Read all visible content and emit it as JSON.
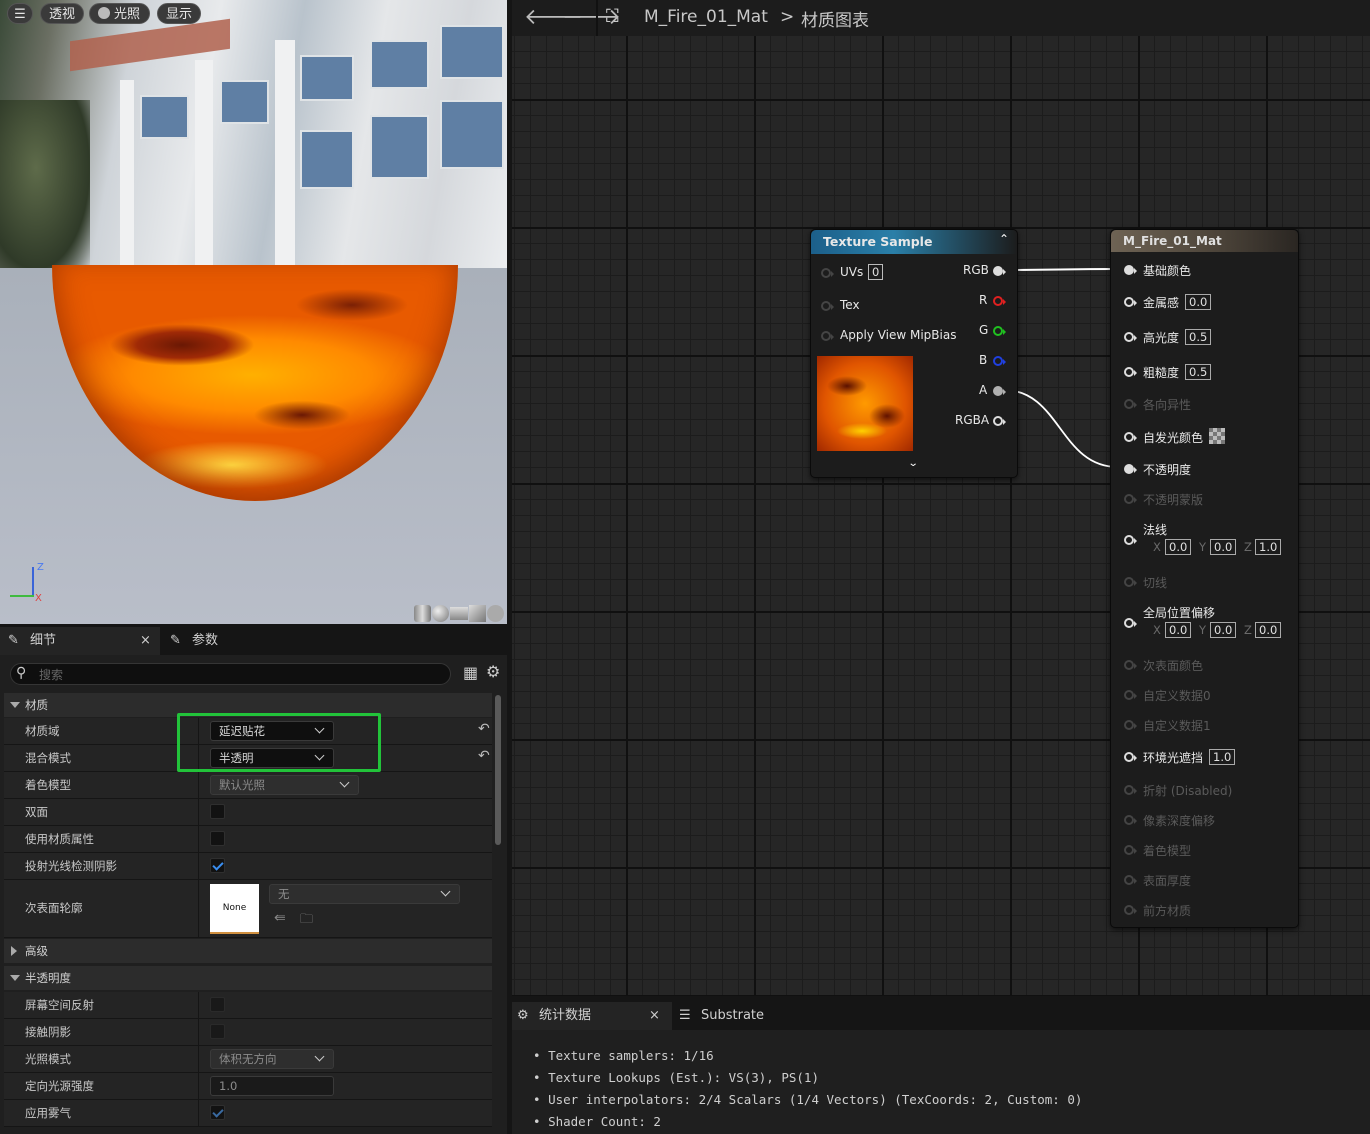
{
  "viewport": {
    "buttons": {
      "menu": "",
      "perspective": "透视",
      "lighting": "光照",
      "show": "显示"
    },
    "axis": {
      "z": "Z",
      "x": "X"
    }
  },
  "details": {
    "tabs": [
      {
        "label": "细节",
        "close": "×"
      },
      {
        "label": "参数"
      }
    ],
    "search_placeholder": "搜索",
    "sections": {
      "material": "材质",
      "advanced": "高级",
      "translucency": "半透明度"
    },
    "rows": {
      "material_domain": {
        "label": "材质域",
        "value": "延迟贴花"
      },
      "blend_mode": {
        "label": "混合模式",
        "value": "半透明"
      },
      "shading_model": {
        "label": "着色模型",
        "value": "默认光照"
      },
      "two_sided": {
        "label": "双面",
        "checked": false
      },
      "use_material_attributes": {
        "label": "使用材质属性",
        "checked": false
      },
      "cast_ray_traced_shadows": {
        "label": "投射光线检测阴影",
        "checked": true
      },
      "subsurface_profile": {
        "label": "次表面轮廓",
        "thumb": "None",
        "value": "无"
      },
      "screen_space_reflections": {
        "label": "屏幕空间反射",
        "checked": false
      },
      "contact_shadows": {
        "label": "接触阴影",
        "checked": false
      },
      "lighting_mode": {
        "label": "光照模式",
        "value": "体积无方向"
      },
      "directional_light_intensity": {
        "label": "定向光源强度",
        "value": "1.0"
      },
      "apply_fog": {
        "label": "应用雾气",
        "checked": true
      }
    },
    "highlight_color": "#22c33a"
  },
  "graph": {
    "breadcrumb": {
      "asset": "M_Fire_01_Mat",
      "sep": ">",
      "page": "材质图表"
    },
    "texture_node": {
      "title": "Texture Sample",
      "inputs": [
        {
          "label": "UVs",
          "value": "0"
        },
        {
          "label": "Tex"
        },
        {
          "label": "Apply View MipBias"
        }
      ],
      "outputs": [
        {
          "label": "RGB",
          "color": "#e0e0e0"
        },
        {
          "label": "R",
          "color": "#e02020"
        },
        {
          "label": "G",
          "color": "#20c020"
        },
        {
          "label": "B",
          "color": "#2040e0"
        },
        {
          "label": "A",
          "color": "#b0b0b0"
        },
        {
          "label": "RGBA",
          "color": "#e0e0e0"
        }
      ]
    },
    "material_node": {
      "title": "M_Fire_01_Mat",
      "pins": {
        "base_color": "基础颜色",
        "metallic": "金属感",
        "metallic_val": "0.0",
        "specular": "高光度",
        "specular_val": "0.5",
        "roughness": "粗糙度",
        "roughness_val": "0.5",
        "anisotropy": "各向异性",
        "emissive": "自发光颜色",
        "opacity": "不透明度",
        "opacity_mask": "不透明蒙版",
        "normal": "法线",
        "normal_x": "0.0",
        "normal_y": "0.0",
        "normal_z": "1.0",
        "tangent": "切线",
        "wpo": "全局位置偏移",
        "wpo_x": "0.0",
        "wpo_y": "0.0",
        "wpo_z": "0.0",
        "subsurface": "次表面颜色",
        "custom0": "自定义数据0",
        "custom1": "自定义数据1",
        "ao": "环境光遮挡",
        "ao_val": "1.0",
        "refraction": "折射 (Disabled)",
        "pdo": "像素深度偏移",
        "shading_model": "着色模型",
        "thickness": "表面厚度",
        "front_material": "前方材质",
        "x": "X",
        "y": "Y",
        "z": "Z"
      }
    }
  },
  "stats": {
    "tabs": [
      {
        "label": "统计数据",
        "close": "×"
      },
      {
        "label": "Substrate"
      }
    ],
    "lines": [
      "Texture samplers: 1/16",
      "Texture Lookups (Est.): VS(3), PS(1)",
      "User interpolators: 2/4 Scalars (1/4 Vectors) (TexCoords: 2, Custom: 0)",
      "Shader Count: 2"
    ]
  }
}
